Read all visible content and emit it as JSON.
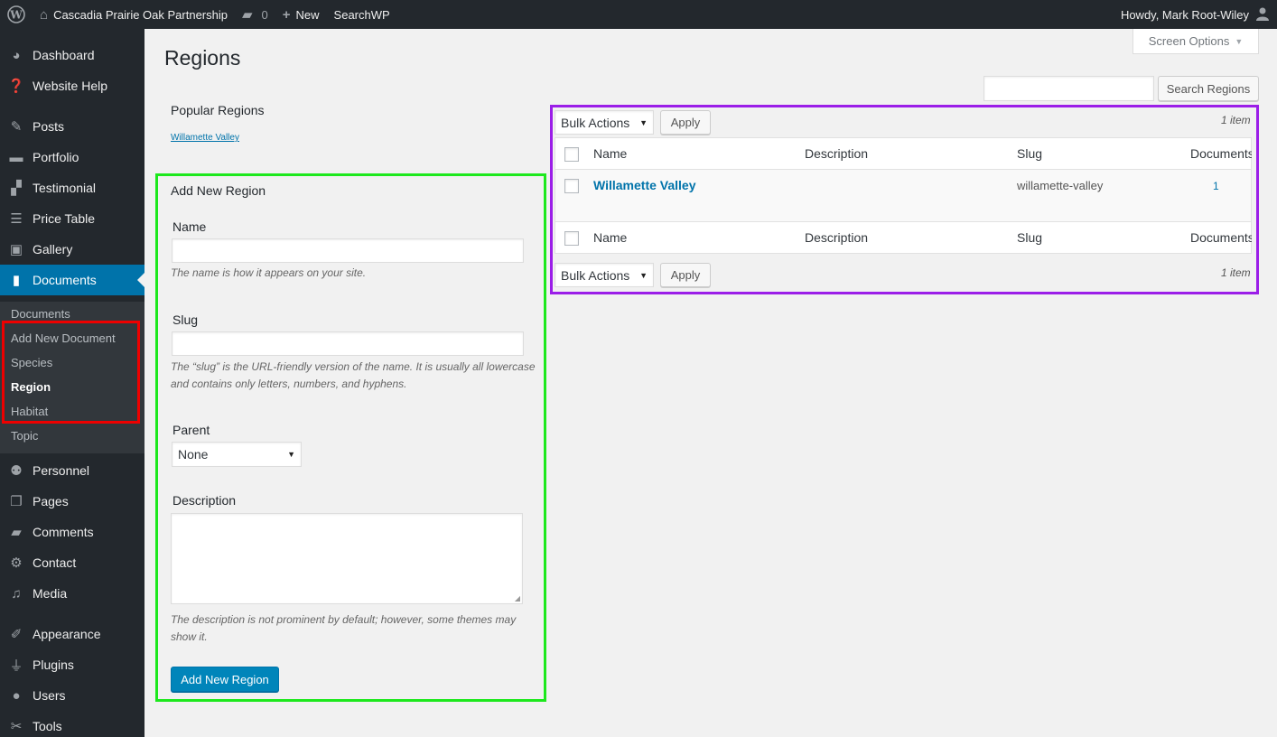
{
  "adminbar": {
    "site_name": "Cascadia Prairie Oak Partnership",
    "comments_count": "0",
    "new_label": "New",
    "searchwp_label": "SearchWP",
    "howdy": "Howdy, Mark Root-Wiley"
  },
  "sidebar": {
    "items": [
      {
        "label": "Dashboard",
        "icon": "dashboard-icon"
      },
      {
        "label": "Website Help",
        "icon": "help-icon"
      },
      {
        "label": "Posts",
        "icon": "pin-icon"
      },
      {
        "label": "Portfolio",
        "icon": "folder-icon"
      },
      {
        "label": "Testimonial",
        "icon": "testimonial-icon"
      },
      {
        "label": "Price Table",
        "icon": "table-icon"
      },
      {
        "label": "Gallery",
        "icon": "gallery-icon"
      },
      {
        "label": "Documents",
        "icon": "book-icon"
      },
      {
        "label": "Personnel",
        "icon": "groups-icon"
      },
      {
        "label": "Pages",
        "icon": "pages-icon"
      },
      {
        "label": "Comments",
        "icon": "comment-icon"
      },
      {
        "label": "Contact",
        "icon": "gear-icon"
      },
      {
        "label": "Media",
        "icon": "media-icon"
      },
      {
        "label": "Appearance",
        "icon": "brush-icon"
      },
      {
        "label": "Plugins",
        "icon": "plugin-icon"
      },
      {
        "label": "Users",
        "icon": "user-icon"
      },
      {
        "label": "Tools",
        "icon": "wrench-icon"
      }
    ],
    "submenu": [
      "Documents",
      "Add New Document",
      "Species",
      "Region",
      "Habitat",
      "Topic"
    ]
  },
  "page": {
    "title": "Regions",
    "screen_options": "Screen Options",
    "search_button": "Search Regions",
    "search_value": ""
  },
  "popular": {
    "title": "Popular Regions",
    "tag": "Willamette Valley"
  },
  "form": {
    "heading": "Add New Region",
    "name_label": "Name",
    "name_value": "",
    "name_help": "The name is how it appears on your site.",
    "slug_label": "Slug",
    "slug_value": "",
    "slug_help": "The “slug” is the URL-friendly version of the name. It is usually all lowercase and contains only letters, numbers, and hyphens.",
    "parent_label": "Parent",
    "parent_value": "None",
    "description_label": "Description",
    "description_help": "The description is not prominent by default; however, some themes may show it.",
    "submit_label": "Add New Region"
  },
  "table": {
    "bulk_actions": "Bulk Actions",
    "apply": "Apply",
    "item_count": "1 item",
    "columns": [
      "Name",
      "Description",
      "Slug",
      "Documents"
    ],
    "rows": [
      {
        "name": "Willamette Valley",
        "description": "",
        "slug": "willamette-valley",
        "count": "1"
      }
    ]
  },
  "colors": {
    "accent": "#0073aa",
    "highlight_red": "#ee0000",
    "highlight_green": "#1de81d",
    "highlight_purple": "#9b1ee8"
  }
}
